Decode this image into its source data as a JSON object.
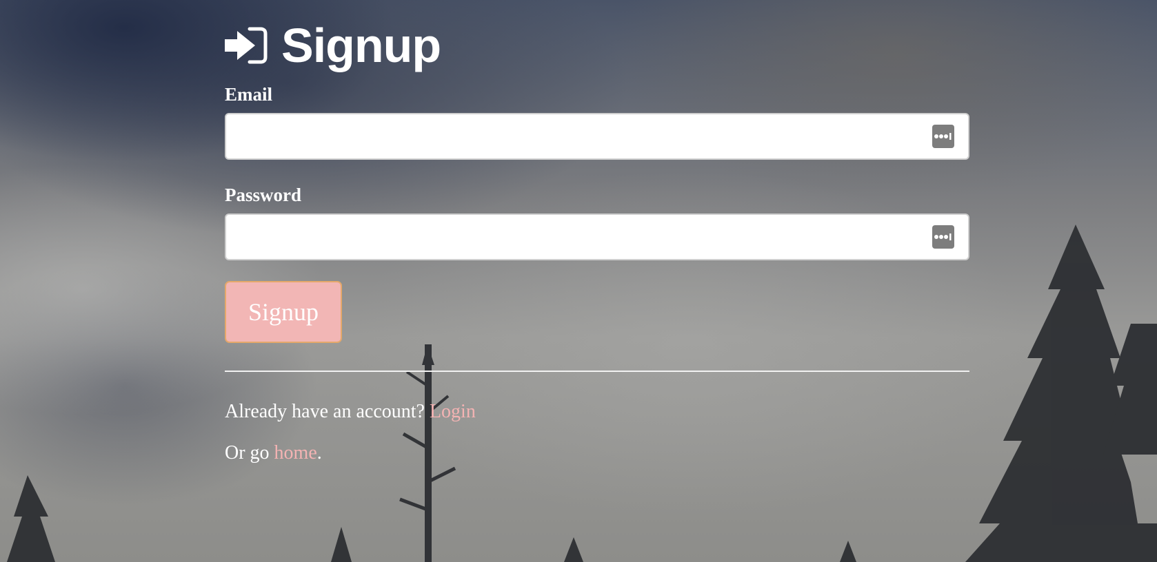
{
  "page": {
    "title": "Signup"
  },
  "form": {
    "email_label": "Email",
    "email_value": "",
    "password_label": "Password",
    "password_value": "",
    "submit_label": "Signup"
  },
  "footer": {
    "account_prompt": "Already have an account?",
    "login_link": "Login",
    "home_prefix": "Or go",
    "home_link": "home",
    "home_suffix": "."
  },
  "icons": {
    "title_icon": "sign-in-icon",
    "field_icon": "password-manager-icon"
  },
  "colors": {
    "button_bg": "#f2b6b5",
    "button_border": "#e5a86a",
    "link": "#f4b3b3",
    "text": "#ffffff"
  }
}
